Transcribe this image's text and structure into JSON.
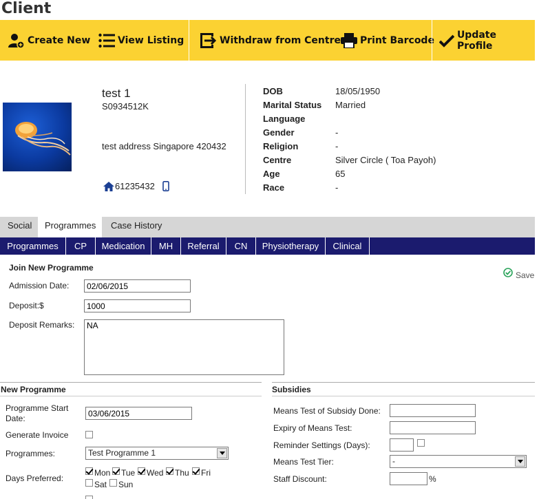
{
  "page_title": "Client",
  "toolbar": {
    "create_new": "Create New",
    "view_listing": "View Listing",
    "withdraw": "Withdraw from Centre",
    "print_barcode": "Print Barcode",
    "update_profile": "Update Profile"
  },
  "client": {
    "name": "test 1",
    "id": "S0934512K",
    "address": "test address Singapore 420432",
    "phone": "61235432"
  },
  "info": {
    "dob_label": "DOB",
    "dob": "18/05/1950",
    "marital_label": "Marital Status",
    "marital": "Married",
    "language_label": "Language",
    "language": "",
    "gender_label": "Gender",
    "gender": "-",
    "religion_label": "Religion",
    "religion": "-",
    "centre_label": "Centre",
    "centre": "Silver Circle ( Toa Payoh)",
    "age_label": "Age",
    "age": "65",
    "race_label": "Race",
    "race": "-"
  },
  "main_tabs": [
    "Social",
    "Programmes",
    "Case History"
  ],
  "sub_tabs": [
    "Programmes",
    "CP",
    "Medication",
    "MH",
    "Referral",
    "CN",
    "Physiotherapy",
    "Clinical"
  ],
  "join": {
    "heading": "Join New Programme",
    "save": "Save",
    "admission_label": "Admission Date:",
    "admission": "02/06/2015",
    "deposit_label": "Deposit:$",
    "deposit": "1000",
    "remarks_label": "Deposit Remarks:",
    "remarks": "NA"
  },
  "new_programme": {
    "heading": "New Programme",
    "start_label_1": "Programme Start",
    "start_label_2": "Date:",
    "start": "03/06/2015",
    "invoice_label": "Generate Invoice",
    "programmes_label": "Programmes:",
    "programme_selected": "Test Programme 1",
    "days_label": "Days Preferred:",
    "days": [
      {
        "name": "Mon",
        "checked": true
      },
      {
        "name": "Tue",
        "checked": true
      },
      {
        "name": "Wed",
        "checked": true
      },
      {
        "name": "Thu",
        "checked": true
      },
      {
        "name": "Fri",
        "checked": true
      },
      {
        "name": "Sat",
        "checked": false
      },
      {
        "name": "Sun",
        "checked": false
      }
    ]
  },
  "subsidies": {
    "heading": "Subsidies",
    "means_done_label": "Means Test of Subsidy Done:",
    "means_done": "",
    "expiry_label": "Expiry of Means Test:",
    "expiry": "",
    "reminder_label": "Reminder Settings (Days):",
    "reminder": "",
    "tier_label": "Means Test Tier:",
    "tier": "-",
    "discount_label": "Staff Discount:",
    "discount": "",
    "percent": "%"
  },
  "colors": {
    "toolbar": "#fbd232",
    "subnav": "#1b1b6e",
    "tabbar": "#d6d6d6"
  }
}
